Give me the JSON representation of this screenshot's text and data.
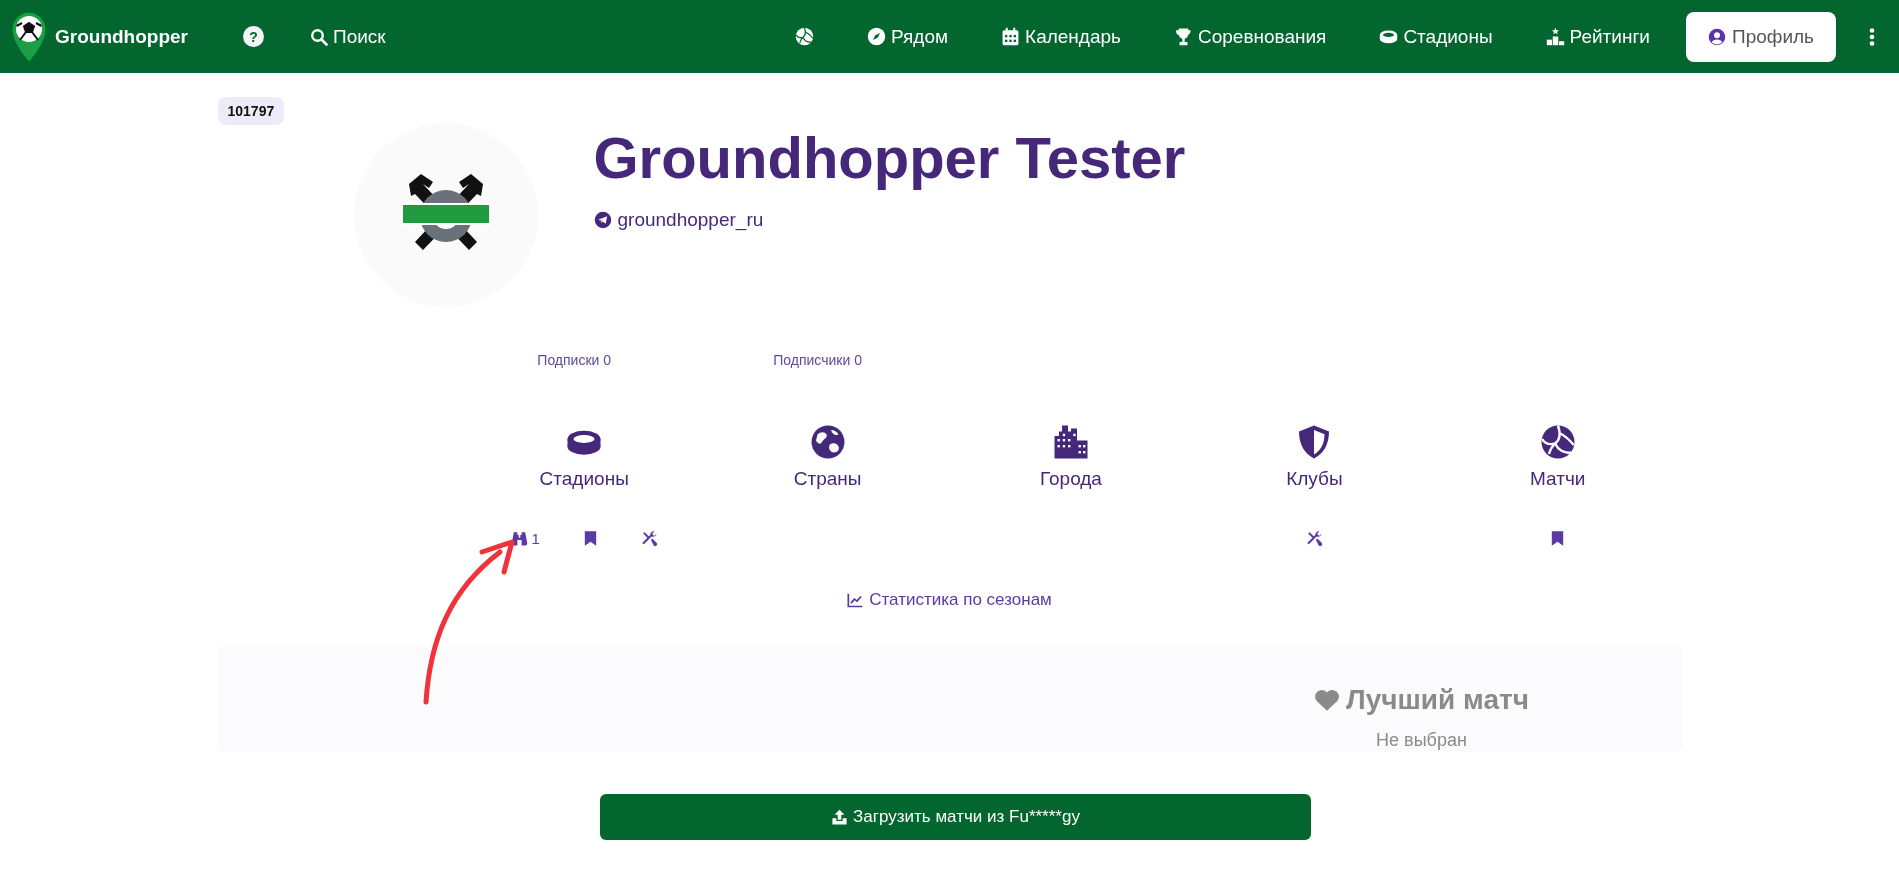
{
  "navbar": {
    "brand": "Groundhopper",
    "help": "?",
    "search": {
      "label": "Поиск"
    },
    "items": [
      {
        "label": "Рядом"
      },
      {
        "label": "Календарь"
      },
      {
        "label": "Соревнования"
      },
      {
        "label": "Стадионы"
      },
      {
        "label": "Рейтинги"
      }
    ],
    "profile_button": "Профиль"
  },
  "profile": {
    "id_badge": "101797",
    "name": "Groundhopper Tester",
    "telegram": "groundhopper_ru",
    "follows": [
      "Подписки 0",
      "Подписчики 0"
    ]
  },
  "categories": [
    {
      "label": "Стадионы",
      "actions": [
        {
          "kind": "visits",
          "count": "1"
        },
        {
          "kind": "bookmark"
        },
        {
          "kind": "tools"
        }
      ]
    },
    {
      "label": "Страны"
    },
    {
      "label": "Города"
    },
    {
      "label": "Клубы",
      "actions": [
        {
          "kind": "tools"
        }
      ]
    },
    {
      "label": "Матчи",
      "actions": [
        {
          "kind": "bookmark"
        }
      ]
    }
  ],
  "stats_link": "Статистика по сезонам",
  "best_match": {
    "title": "Лучший матч",
    "value": "Не выбран"
  },
  "upload_button": "Загрузить матчи из Fu*****gy"
}
